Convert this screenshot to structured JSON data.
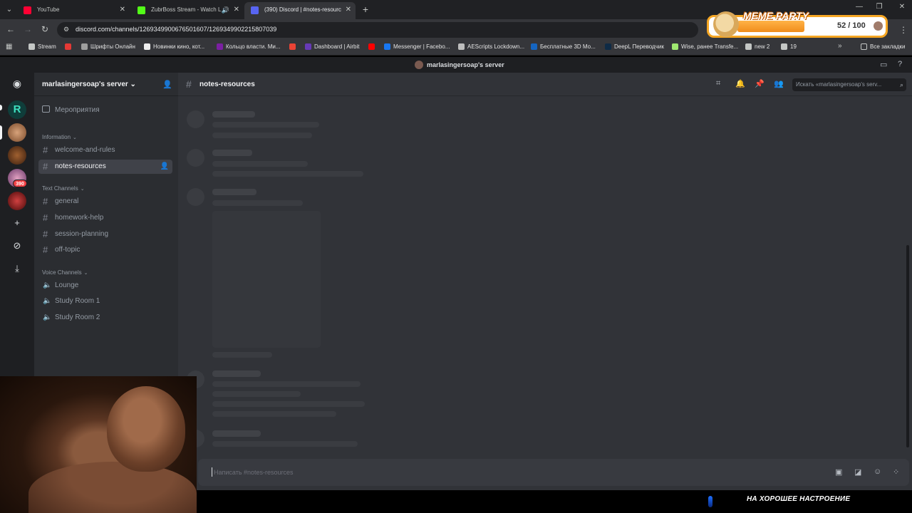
{
  "browser": {
    "tabs": [
      {
        "title": "YouTube",
        "favicon_color": "#ff0033"
      },
      {
        "title": "ZubrBoss Stream - Watch L",
        "favicon_color": "#53fc18"
      },
      {
        "title": "(390) Discord | #notes-resourc",
        "favicon_color": "#5865f2"
      }
    ],
    "url": "discord.com/channels/1269349900676501607/1269349902215807039",
    "bookmarks": [
      {
        "label": "Stream",
        "color": "#c4c7c5"
      },
      {
        "label": "",
        "color": "#e53935"
      },
      {
        "label": "Шрифты Онлайн",
        "color": "#9e9e9e"
      },
      {
        "label": "Новинки кино, кот...",
        "color": "#eeeeee"
      },
      {
        "label": "Кольцо власти. Ми...",
        "color": "#7b1fa2"
      },
      {
        "label": "",
        "color": "#ea4335"
      },
      {
        "label": "Dashboard | Airbit",
        "color": "#673ab7"
      },
      {
        "label": "",
        "color": "#ff0000"
      },
      {
        "label": "Messenger | Facebo...",
        "color": "#1877f2"
      },
      {
        "label": "AEScripts Lockdown...",
        "color": "#bdbdbd"
      },
      {
        "label": "Бесплатные 3D Мо...",
        "color": "#1565c0"
      },
      {
        "label": "DeepL Переводчик",
        "color": "#0f2b46"
      },
      {
        "label": "Wise, ранее Transfe...",
        "color": "#9fe870"
      },
      {
        "label": "new 2",
        "color": "#c4c7c5"
      },
      {
        "label": "19",
        "color": "#c4c7c5"
      }
    ],
    "all_bookmarks": "Все закладки"
  },
  "overlay": {
    "title": "MEME PARTY",
    "score": "52 / 100",
    "progress_fraction": 0.52,
    "banner_text": "НА ХОРОШЕЕ НАСТРОЕНИЕ"
  },
  "discord": {
    "window_title": "marlasingersoap's server",
    "rail": {
      "badge": "390",
      "servers": [
        {
          "color": "#0f3d3a",
          "glyph": "R"
        },
        {
          "color": "#c98a5a",
          "glyph": ""
        },
        {
          "color": "#6b3a1f",
          "glyph": ""
        },
        {
          "color": "#b06a8a",
          "glyph": ""
        },
        {
          "color": "#8a1a1a",
          "glyph": ""
        }
      ]
    },
    "server_name": "marlasingersoap's server",
    "events_label": "Мероприятия",
    "categories": {
      "information": "Information",
      "text": "Text Channels",
      "voice": "Voice Channels"
    },
    "info_channels": [
      "welcome-and-rules",
      "notes-resources"
    ],
    "text_channels": [
      "general",
      "homework-help",
      "session-planning",
      "off-topic"
    ],
    "voice_channels": [
      "Lounge",
      "Study Room 1",
      "Study Room 2"
    ],
    "current_channel": "notes-resources",
    "search_placeholder": "Искать «marlasingersoap's serv...",
    "composer_placeholder": "Написать #notes-resources"
  }
}
